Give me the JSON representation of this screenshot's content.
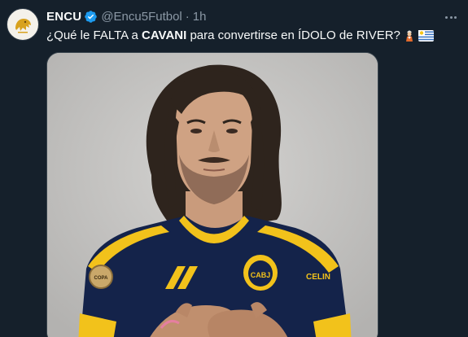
{
  "tweet": {
    "display_name": "ENCU",
    "handle": "@Encu5Futbol",
    "separator": "·",
    "time": "1h",
    "text_parts": [
      "¿Qué le FALTA a ",
      "CAVANI",
      " para convertirse en ÍDOLO de RIVER?"
    ]
  },
  "icons": {
    "avatar": "lion-logo",
    "verified": "verified-badge-icon",
    "more": "more-options-icon",
    "emoji_1": "genie-emoji",
    "emoji_2": "uruguay-flag-emoji"
  },
  "media": {
    "jersey_text": "CABJ",
    "sponsor_text": "CELIN",
    "badge_text": "COPA"
  },
  "colors": {
    "background": "#15202b",
    "text": "#f7f9f9",
    "muted": "#8b98a5",
    "verified": "#1d9bf0",
    "jersey_navy": "#14234a",
    "jersey_gold": "#f2c21b"
  }
}
